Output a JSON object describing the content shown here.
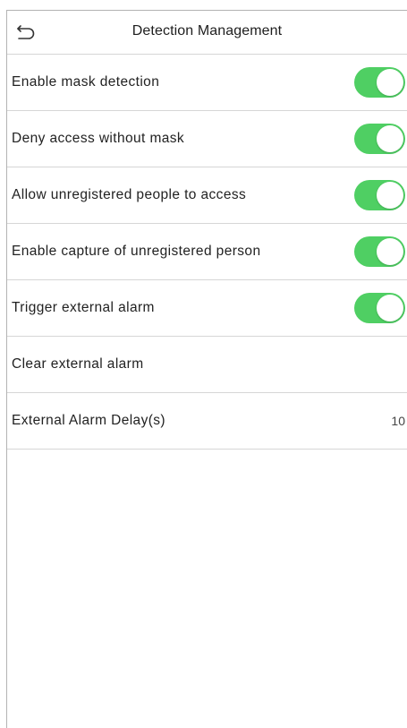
{
  "header": {
    "title": "Detection Management",
    "back_icon": "back-arrow-icon"
  },
  "colors": {
    "toggle_on": "#4fcf63",
    "divider": "#d6d6d6",
    "text": "#222222"
  },
  "settings": [
    {
      "label": "Enable mask detection",
      "toggle": true,
      "on": true
    },
    {
      "label": "Deny access without mask",
      "toggle": true,
      "on": true
    },
    {
      "label": "Allow unregistered people to access",
      "toggle": true,
      "on": true
    },
    {
      "label": "Enable capture of unregistered person",
      "toggle": true,
      "on": true
    },
    {
      "label": "Trigger external alarm",
      "toggle": true,
      "on": true
    },
    {
      "label": "Clear external alarm"
    },
    {
      "label": "External Alarm Delay(s)",
      "value": "10"
    }
  ]
}
